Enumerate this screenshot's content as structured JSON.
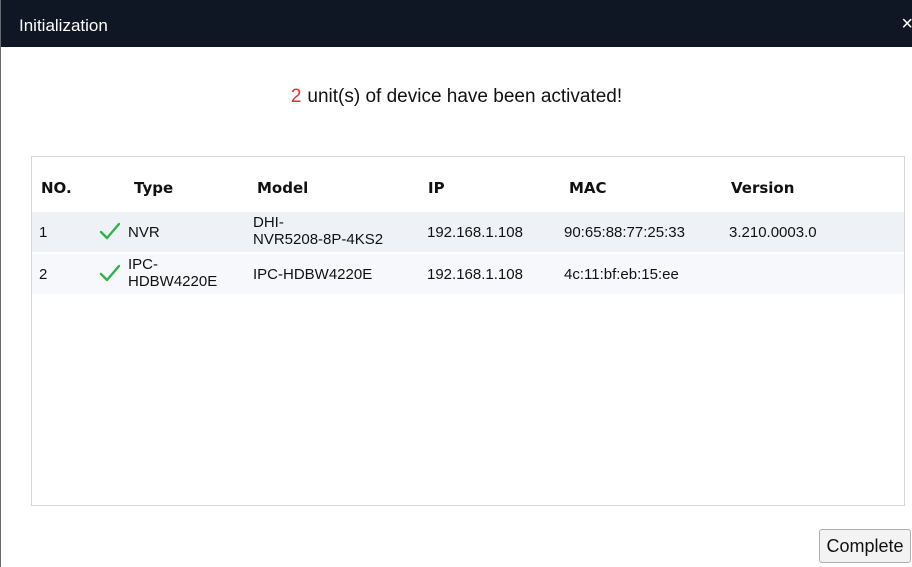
{
  "window": {
    "title": "Initialization",
    "close_glyph": "×"
  },
  "summary": {
    "count": "2",
    "message": "unit(s) of device have been activated!"
  },
  "table": {
    "headers": [
      "NO.",
      "Type",
      "Model",
      "IP",
      "MAC",
      "Version"
    ],
    "rows": [
      {
        "no": "1",
        "status": "check-icon",
        "type_line1": "NVR",
        "type_line2": "",
        "model_line1": "DHI-",
        "model_line2": "NVR5208-8P-4KS2",
        "ip": "192.168.1.108",
        "mac": "90:65:88:77:25:33",
        "version": "3.210.0003.0"
      },
      {
        "no": "2",
        "status": "check-icon",
        "type_line1": "IPC-",
        "type_line2": "HDBW4220E",
        "model_line1": "IPC-HDBW4220E",
        "model_line2": "",
        "ip": "192.168.1.108",
        "mac": "4c:11:bf:eb:15:ee",
        "version": ""
      }
    ]
  },
  "footer": {
    "complete_label": "Complete"
  },
  "colors": {
    "titlebar": "#0f1724",
    "count": "#e03030",
    "check": "#2fb24a"
  }
}
